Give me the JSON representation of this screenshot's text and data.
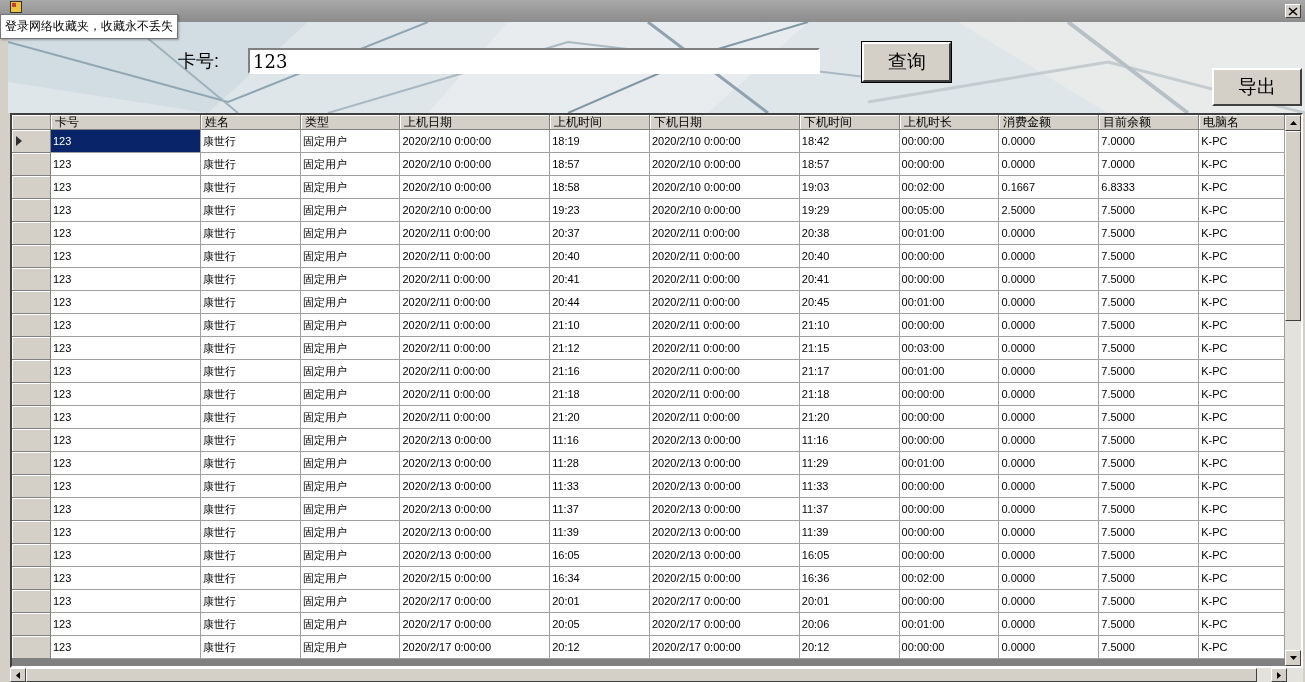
{
  "tooltip": "登录网络收藏夹，收藏永不丢失",
  "search": {
    "label": "卡号:",
    "value": "123",
    "button": "查询"
  },
  "export_button": "导出",
  "table": {
    "columns": [
      "卡号",
      "姓名",
      "类型",
      "上机日期",
      "上机时间",
      "下机日期",
      "下机时间",
      "上机时长",
      "消费金额",
      "目前余额",
      "电脑名"
    ],
    "rows": [
      {
        "selected": true,
        "cells": [
          "123",
          "康世行",
          "固定用户",
          "2020/2/10 0:00:00",
          "18:19",
          "2020/2/10 0:00:00",
          "18:42",
          "00:00:00",
          "0.0000",
          "7.0000",
          "K-PC"
        ]
      },
      {
        "selected": false,
        "cells": [
          "123",
          "康世行",
          "固定用户",
          "2020/2/10 0:00:00",
          "18:57",
          "2020/2/10 0:00:00",
          "18:57",
          "00:00:00",
          "0.0000",
          "7.0000",
          "K-PC"
        ]
      },
      {
        "selected": false,
        "cells": [
          "123",
          "康世行",
          "固定用户",
          "2020/2/10 0:00:00",
          "18:58",
          "2020/2/10 0:00:00",
          "19:03",
          "00:02:00",
          "0.1667",
          "6.8333",
          "K-PC"
        ]
      },
      {
        "selected": false,
        "cells": [
          "123",
          "康世行",
          "固定用户",
          "2020/2/10 0:00:00",
          "19:23",
          "2020/2/10 0:00:00",
          "19:29",
          "00:05:00",
          "2.5000",
          "7.5000",
          "K-PC"
        ]
      },
      {
        "selected": false,
        "cells": [
          "123",
          "康世行",
          "固定用户",
          "2020/2/11 0:00:00",
          "20:37",
          "2020/2/11 0:00:00",
          "20:38",
          "00:01:00",
          "0.0000",
          "7.5000",
          "K-PC"
        ]
      },
      {
        "selected": false,
        "cells": [
          "123",
          "康世行",
          "固定用户",
          "2020/2/11 0:00:00",
          "20:40",
          "2020/2/11 0:00:00",
          "20:40",
          "00:00:00",
          "0.0000",
          "7.5000",
          "K-PC"
        ]
      },
      {
        "selected": false,
        "cells": [
          "123",
          "康世行",
          "固定用户",
          "2020/2/11 0:00:00",
          "20:41",
          "2020/2/11 0:00:00",
          "20:41",
          "00:00:00",
          "0.0000",
          "7.5000",
          "K-PC"
        ]
      },
      {
        "selected": false,
        "cells": [
          "123",
          "康世行",
          "固定用户",
          "2020/2/11 0:00:00",
          "20:44",
          "2020/2/11 0:00:00",
          "20:45",
          "00:01:00",
          "0.0000",
          "7.5000",
          "K-PC"
        ]
      },
      {
        "selected": false,
        "cells": [
          "123",
          "康世行",
          "固定用户",
          "2020/2/11 0:00:00",
          "21:10",
          "2020/2/11 0:00:00",
          "21:10",
          "00:00:00",
          "0.0000",
          "7.5000",
          "K-PC"
        ]
      },
      {
        "selected": false,
        "cells": [
          "123",
          "康世行",
          "固定用户",
          "2020/2/11 0:00:00",
          "21:12",
          "2020/2/11 0:00:00",
          "21:15",
          "00:03:00",
          "0.0000",
          "7.5000",
          "K-PC"
        ]
      },
      {
        "selected": false,
        "cells": [
          "123",
          "康世行",
          "固定用户",
          "2020/2/11 0:00:00",
          "21:16",
          "2020/2/11 0:00:00",
          "21:17",
          "00:01:00",
          "0.0000",
          "7.5000",
          "K-PC"
        ]
      },
      {
        "selected": false,
        "cells": [
          "123",
          "康世行",
          "固定用户",
          "2020/2/11 0:00:00",
          "21:18",
          "2020/2/11 0:00:00",
          "21:18",
          "00:00:00",
          "0.0000",
          "7.5000",
          "K-PC"
        ]
      },
      {
        "selected": false,
        "cells": [
          "123",
          "康世行",
          "固定用户",
          "2020/2/11 0:00:00",
          "21:20",
          "2020/2/11 0:00:00",
          "21:20",
          "00:00:00",
          "0.0000",
          "7.5000",
          "K-PC"
        ]
      },
      {
        "selected": false,
        "cells": [
          "123",
          "康世行",
          "固定用户",
          "2020/2/13 0:00:00",
          "11:16",
          "2020/2/13 0:00:00",
          "11:16",
          "00:00:00",
          "0.0000",
          "7.5000",
          "K-PC"
        ]
      },
      {
        "selected": false,
        "cells": [
          "123",
          "康世行",
          "固定用户",
          "2020/2/13 0:00:00",
          "11:28",
          "2020/2/13 0:00:00",
          "11:29",
          "00:01:00",
          "0.0000",
          "7.5000",
          "K-PC"
        ]
      },
      {
        "selected": false,
        "cells": [
          "123",
          "康世行",
          "固定用户",
          "2020/2/13 0:00:00",
          "11:33",
          "2020/2/13 0:00:00",
          "11:33",
          "00:00:00",
          "0.0000",
          "7.5000",
          "K-PC"
        ]
      },
      {
        "selected": false,
        "cells": [
          "123",
          "康世行",
          "固定用户",
          "2020/2/13 0:00:00",
          "11:37",
          "2020/2/13 0:00:00",
          "11:37",
          "00:00:00",
          "0.0000",
          "7.5000",
          "K-PC"
        ]
      },
      {
        "selected": false,
        "cells": [
          "123",
          "康世行",
          "固定用户",
          "2020/2/13 0:00:00",
          "11:39",
          "2020/2/13 0:00:00",
          "11:39",
          "00:00:00",
          "0.0000",
          "7.5000",
          "K-PC"
        ]
      },
      {
        "selected": false,
        "cells": [
          "123",
          "康世行",
          "固定用户",
          "2020/2/13 0:00:00",
          "16:05",
          "2020/2/13 0:00:00",
          "16:05",
          "00:00:00",
          "0.0000",
          "7.5000",
          "K-PC"
        ]
      },
      {
        "selected": false,
        "cells": [
          "123",
          "康世行",
          "固定用户",
          "2020/2/15 0:00:00",
          "16:34",
          "2020/2/15 0:00:00",
          "16:36",
          "00:02:00",
          "0.0000",
          "7.5000",
          "K-PC"
        ]
      },
      {
        "selected": false,
        "cells": [
          "123",
          "康世行",
          "固定用户",
          "2020/2/17 0:00:00",
          "20:01",
          "2020/2/17 0:00:00",
          "20:01",
          "00:00:00",
          "0.0000",
          "7.5000",
          "K-PC"
        ]
      },
      {
        "selected": false,
        "cells": [
          "123",
          "康世行",
          "固定用户",
          "2020/2/17 0:00:00",
          "20:05",
          "2020/2/17 0:00:00",
          "20:06",
          "00:01:00",
          "0.0000",
          "7.5000",
          "K-PC"
        ]
      },
      {
        "selected": false,
        "cells": [
          "123",
          "康世行",
          "固定用户",
          "2020/2/17 0:00:00",
          "20:12",
          "2020/2/17 0:00:00",
          "20:12",
          "00:00:00",
          "0.0000",
          "7.5000",
          "K-PC"
        ]
      }
    ]
  }
}
